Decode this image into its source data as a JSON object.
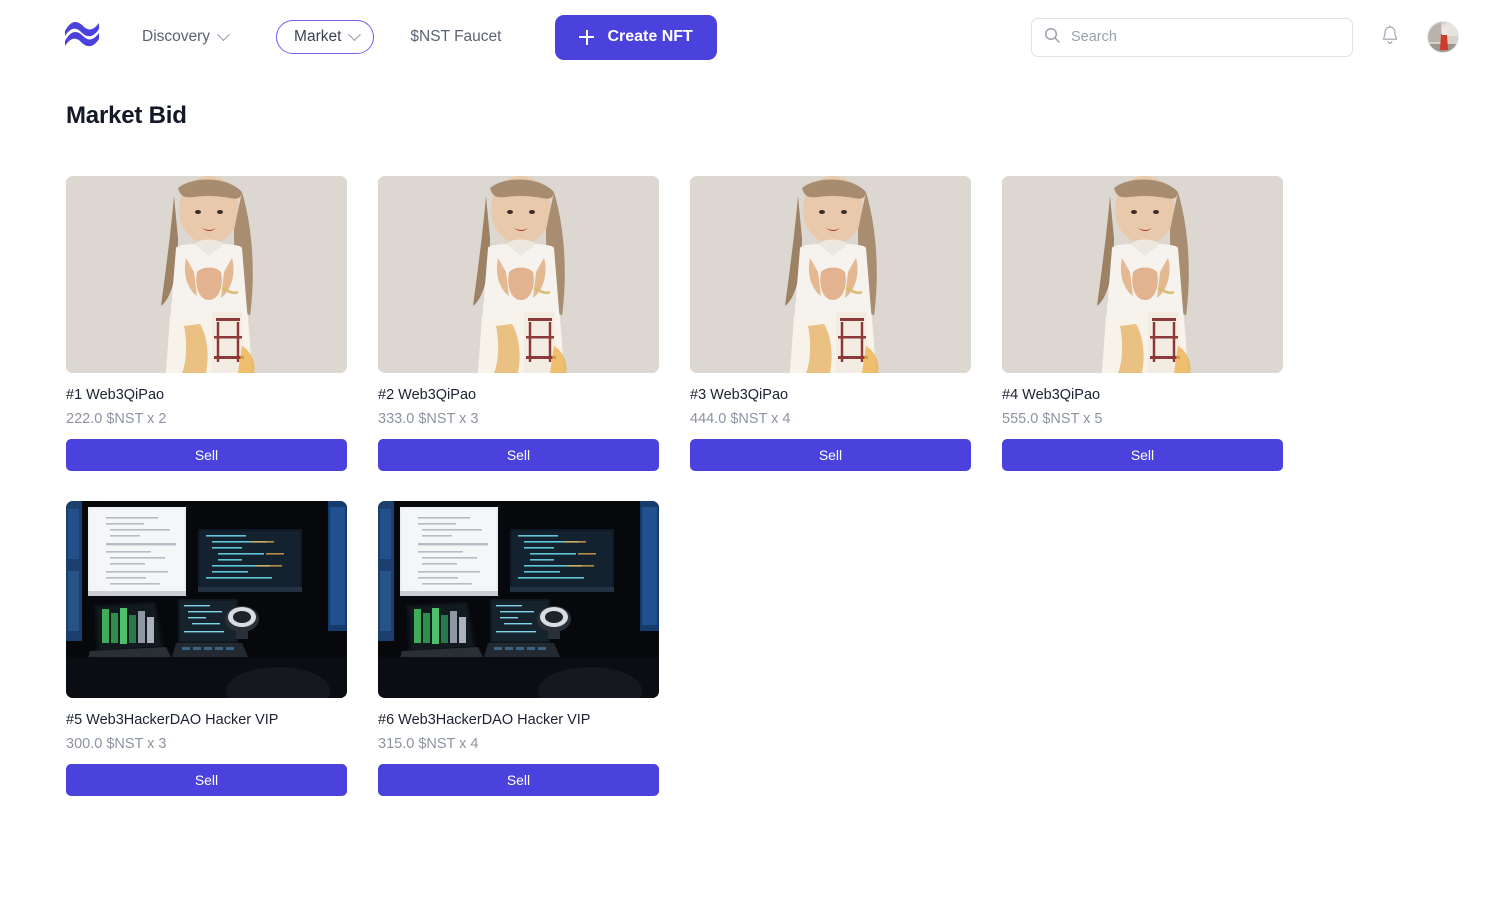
{
  "navbar": {
    "logo_name": "logo-wave-icon",
    "links": [
      {
        "label": "Discovery",
        "has_chevron": true,
        "style": "plain"
      },
      {
        "label": "Market",
        "has_chevron": true,
        "style": "pill"
      },
      {
        "label": "$NST Faucet",
        "has_chevron": false,
        "style": "faucet"
      }
    ],
    "create_button": "Create NFT",
    "search": {
      "placeholder": "Search",
      "value": "",
      "icon": "search-icon"
    },
    "notification_icon": "bell-icon",
    "avatar_name": "user-avatar"
  },
  "main": {
    "page_title": "Market Bid",
    "cards": [
      {
        "title": "#1 Web3QiPao",
        "price": "222.0 $NST x 2",
        "action": "Sell",
        "image": "qipao"
      },
      {
        "title": "#2 Web3QiPao",
        "price": "333.0 $NST x 3",
        "action": "Sell",
        "image": "qipao"
      },
      {
        "title": "#3 Web3QiPao",
        "price": "444.0 $NST x 4",
        "action": "Sell",
        "image": "qipao"
      },
      {
        "title": "#4 Web3QiPao",
        "price": "555.0 $NST x 5",
        "action": "Sell",
        "image": "qipao"
      },
      {
        "title": "#5 Web3HackerDAO Hacker VIP",
        "price": "300.0 $NST x 3",
        "action": "Sell",
        "image": "desk"
      },
      {
        "title": "#6 Web3HackerDAO Hacker VIP",
        "price": "315.0 $NST x 4",
        "action": "Sell",
        "image": "desk"
      }
    ]
  },
  "colors": {
    "accent": "#4b42dd",
    "pill_border": "#6c63e8",
    "title": "#121826",
    "muted": "#8d949f"
  }
}
